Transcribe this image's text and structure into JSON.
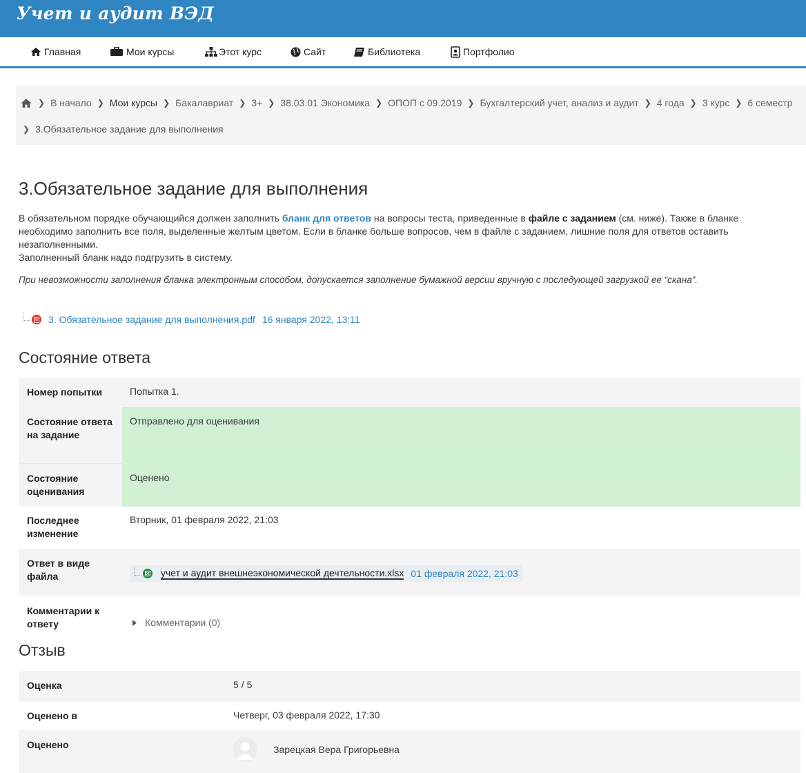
{
  "header": {
    "site_title": "Учет и аудит ВЭД"
  },
  "nav": {
    "home": "Главная",
    "my_courses": "Мои курсы",
    "this_course": "Этот курс",
    "site": "Сайт",
    "library": "Библиотека",
    "portfolio": "Портфолио"
  },
  "breadcrumb": {
    "items": [
      "В начало",
      "Мои курсы",
      "Бакалавриат",
      "3+",
      "38.03.01 Экономика",
      "ОПОП с 09.2019",
      "Бухгалтерский учет, анализ и аудит",
      "4 года",
      "3 курс",
      "6 семестр"
    ],
    "current": "3.Обязательное задание для выполнения"
  },
  "page": {
    "title": "3.Обязательное задание для выполнения",
    "intro_p1": "В обязательном порядке обучающийся должен заполнить ",
    "intro_link": "бланк для ответов",
    "intro_p2": " на вопросы теста, приведенные в ",
    "intro_bold": "файле с заданием",
    "intro_p3": " (см. ниже). Также в бланке необходимо заполнить все поля, выделенные желтым цветом. Если в бланке больше вопросов, чем в файле с заданием, лишние поля для ответов оставить незаполненными.",
    "intro_p4": "Заполненный бланк надо подгрузить в систему.",
    "note": "При невозможности заполнения бланка электронным способом, допускается заполнение бумажной версии вручную с последующей загрузкой ее “скана”.",
    "attachment": {
      "name": "3. Обязательное задание для выполнения.pdf",
      "date": "16 января 2022, 13:11"
    }
  },
  "submission": {
    "title": "Состояние ответа",
    "attempt_label": "Номер попытки",
    "attempt_value": "Попытка 1.",
    "status_label": "Состояние ответа на задание",
    "status_value": "Отправлено для оценивания",
    "grading_label": "Состояние оценивания",
    "grading_value": "Оценено",
    "modified_label": "Последнее изменение",
    "modified_value": "Вторник, 01 февраля 2022, 21:03",
    "file_label": "Ответ в виде файла",
    "file_name": "учет и аудит внешнеэкономической дечтельности.xlsx",
    "file_date": "01 февраля 2022, 21:03",
    "comments_label": "Комментарии к ответу",
    "comments_value": "Комментарии (0)"
  },
  "feedback": {
    "title": "Отзыв",
    "grade_label": "Оценка",
    "grade_value": "5 / 5",
    "graded_on_label": "Оценено в",
    "graded_on_value": "Четверг, 03 февраля 2022, 17:30",
    "graded_by_label": "Оценено",
    "graded_by_value": "Зарецкая Вера Григорьевна"
  },
  "colors": {
    "brand": "#2f86c2",
    "status_green": "#d1f0d3",
    "row_grey": "#f4f4f4"
  }
}
